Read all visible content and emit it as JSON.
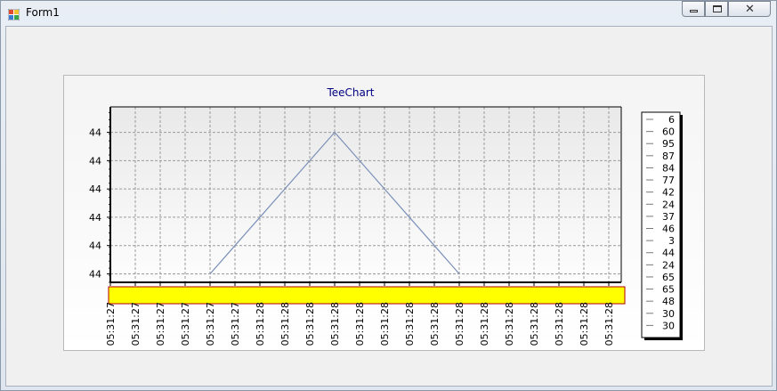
{
  "window": {
    "title": "Form1",
    "controls": {
      "minimize": "minimize-icon",
      "restore": "restore-icon",
      "close": "close-icon"
    }
  },
  "chart_data": {
    "type": "line",
    "title": "TeeChart",
    "y_ticks": [
      "44",
      "44",
      "44",
      "44",
      "44",
      "44"
    ],
    "x_ticks": [
      "05:31:27",
      "05:31:27",
      "05:31:27",
      "05:31:27",
      "05:31:27",
      "05:31:27",
      "05:31:28",
      "05:31:28",
      "05:31:28",
      "05:31:28",
      "05:31:28",
      "05:31:28",
      "05:31:28",
      "05:31:28",
      "05:31:28",
      "05:31:28",
      "05:31:28",
      "05:31:28",
      "05:31:28",
      "05:31:28",
      "05:31:28"
    ],
    "x": [
      4,
      5,
      6,
      7,
      8,
      9,
      10,
      11,
      12,
      13,
      14
    ],
    "values": [
      0,
      1,
      2,
      3,
      4,
      5,
      4,
      3,
      2,
      1,
      0
    ],
    "x_range": [
      0,
      20.5
    ],
    "y_range": [
      -0.3,
      5.9
    ],
    "grid": true,
    "legend_placement": "right",
    "legend": [
      "6",
      "60",
      "95",
      "87",
      "84",
      "77",
      "42",
      "24",
      "37",
      "46",
      "3",
      "44",
      "24",
      "65",
      "65",
      "48",
      "30",
      "30"
    ],
    "colors": {
      "line": "#7a8fb8",
      "axis_label_band": "#ffff00",
      "title": "#000080"
    }
  }
}
